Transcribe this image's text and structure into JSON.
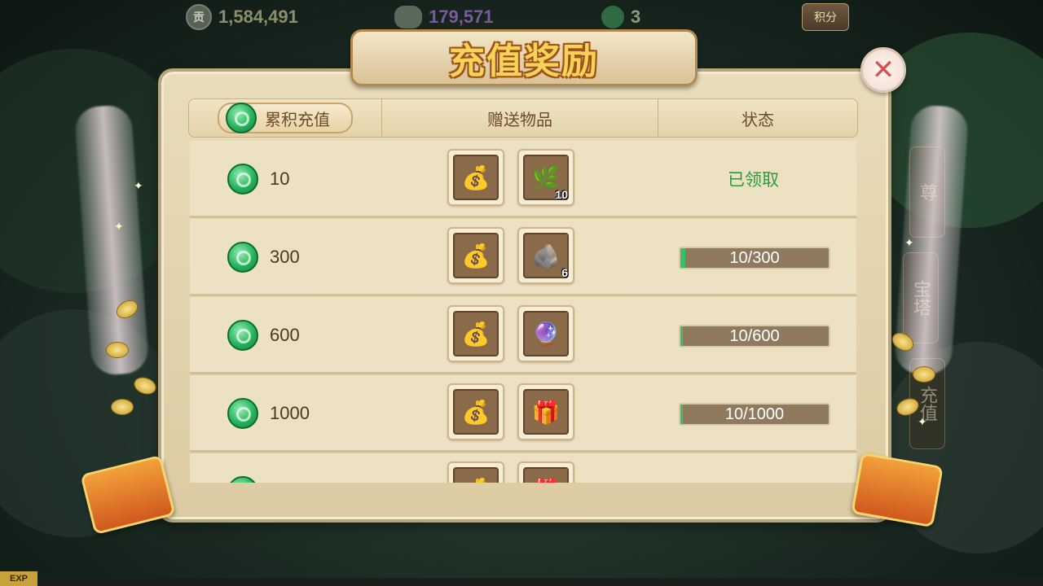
{
  "hud": {
    "gong_icon": "贡",
    "currency1": "1,584,491",
    "currency2": "179,571",
    "currency3": "3",
    "score_button": "积分",
    "exp_label": "EXP"
  },
  "side_tabs": [
    "尊",
    "宝塔",
    "充值"
  ],
  "dialog": {
    "title": "充值奖励",
    "close_icon": "✕",
    "headers": {
      "cumulative": "累积充值",
      "gift_items": "赠送物品",
      "status": "状态"
    },
    "rows": [
      {
        "amount": "10",
        "items": [
          {
            "icon": "money-bag-icon",
            "glyph": "💰",
            "count": ""
          },
          {
            "icon": "herb-flask-icon",
            "glyph": "🌿",
            "count": "10"
          }
        ],
        "status_text": "已领取",
        "progress": null
      },
      {
        "amount": "300",
        "items": [
          {
            "icon": "money-bag-icon",
            "glyph": "💰",
            "count": ""
          },
          {
            "icon": "ore-stone-icon",
            "glyph": "🪨",
            "count": "6"
          }
        ],
        "status_text": "",
        "progress": {
          "label": "10/300",
          "value": 10,
          "max": 300
        }
      },
      {
        "amount": "600",
        "items": [
          {
            "icon": "money-bag-icon",
            "glyph": "💰",
            "count": ""
          },
          {
            "icon": "crystal-orb-icon",
            "glyph": "🔮",
            "count": ""
          }
        ],
        "status_text": "",
        "progress": {
          "label": "10/600",
          "value": 10,
          "max": 600
        }
      },
      {
        "amount": "1000",
        "items": [
          {
            "icon": "money-bag-icon",
            "glyph": "💰",
            "count": ""
          },
          {
            "icon": "gift-pouch-icon",
            "glyph": "🎁",
            "count": ""
          }
        ],
        "status_text": "",
        "progress": {
          "label": "10/1000",
          "value": 10,
          "max": 1000
        }
      },
      {
        "amount": "",
        "items": [
          {
            "icon": "money-bag-icon",
            "glyph": "💰",
            "count": ""
          },
          {
            "icon": "gift-pouch-icon",
            "glyph": "🎁",
            "count": ""
          }
        ],
        "status_text": "",
        "progress": null
      }
    ]
  },
  "colors": {
    "claimed_green": "#2c9a3c",
    "progress_fill": "#35c06a",
    "title_gold": "#f7d25a",
    "close_red": "#d8514c"
  }
}
